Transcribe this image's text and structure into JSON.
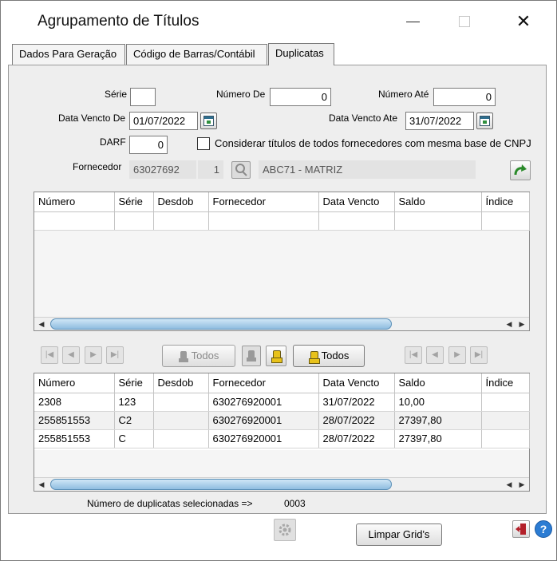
{
  "window": {
    "title": "Agrupamento de Títulos",
    "close_glyph": "✕"
  },
  "tabs": [
    {
      "label": "Dados Para Geração"
    },
    {
      "label": "Código de Barras/Contábil"
    },
    {
      "label": "Duplicatas",
      "active": true
    }
  ],
  "filters": {
    "serie_label": "Série",
    "serie_value": "",
    "numero_de_label": "Número De",
    "numero_de_value": "0",
    "numero_ate_label": "Número Até",
    "numero_ate_value": "0",
    "data_vencto_de_label": "Data Vencto De",
    "data_vencto_de_value": "01/07/2022",
    "data_vencto_ate_label": "Data Vencto Ate",
    "data_vencto_ate_value": "31/07/2022",
    "darf_label": "DARF",
    "darf_value": "0",
    "considerar_label": "Considerar títulos de todos fornecedores com mesma base de CNPJ",
    "considerar_checked": false,
    "fornecedor_label": "Fornecedor",
    "fornecedor_code": "63027692",
    "fornecedor_seq": "1",
    "fornecedor_name": "ABC71 - MATRIZ"
  },
  "columns": [
    "Número",
    "Série",
    "Desdob",
    "Fornecedor",
    "Data Vencto",
    "Saldo",
    "Índice"
  ],
  "top_grid": {
    "rows": []
  },
  "middle_toolbar": {
    "todos_left_label": "Todos",
    "todos_right_label": "Todos"
  },
  "bottom_grid": {
    "rows": [
      {
        "numero": "2308",
        "serie": "123",
        "desdob": "",
        "fornecedor": "630276920001",
        "data_vencto": "31/07/2022",
        "saldo": "10,00",
        "indice": ""
      },
      {
        "numero": "255851553",
        "serie": "C2",
        "desdob": "",
        "fornecedor": "630276920001",
        "data_vencto": "28/07/2022",
        "saldo": "27397,80",
        "indice": ""
      },
      {
        "numero": "255851553",
        "serie": "C",
        "desdob": "",
        "fornecedor": "630276920001",
        "data_vencto": "28/07/2022",
        "saldo": "27397,80",
        "indice": ""
      }
    ]
  },
  "summary": {
    "label": "Número de duplicatas selecionadas =>",
    "count": "0003"
  },
  "footer": {
    "limpar_label": "Limpar Grid's"
  },
  "icons": {
    "calendar": "calendar-icon",
    "search": "search-icon",
    "refresh": "refresh-arrow-icon",
    "gear": "gear-icon",
    "exit": "exit-door-icon",
    "help": "help-icon"
  }
}
